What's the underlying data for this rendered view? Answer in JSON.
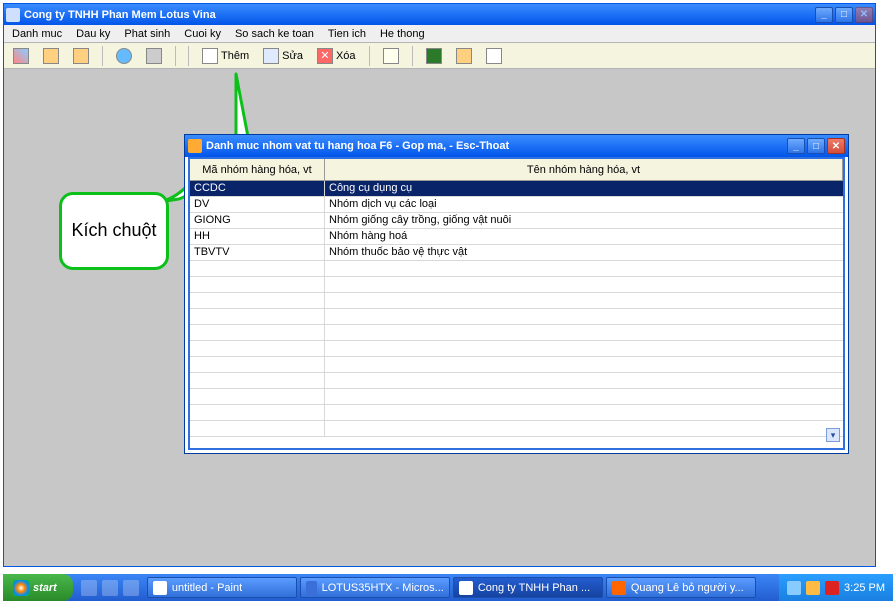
{
  "window": {
    "title": "Cong ty TNHH Phan Mem Lotus Vina"
  },
  "menu": [
    "Danh muc",
    "Dau ky",
    "Phat sinh",
    "Cuoi ky",
    "So sach ke toan",
    "Tien ich",
    "He thong"
  ],
  "toolbar": {
    "them": "Thêm",
    "sua": "Sửa",
    "xoa": "Xóa"
  },
  "callout": {
    "text": "Kích chuột"
  },
  "dialog": {
    "title": "Danh muc nhom vat tu hang hoa   F6 - Gop ma, - Esc-Thoat",
    "columns": {
      "code": "Mã nhóm hàng hóa, vt",
      "name": "Tên nhóm hàng hóa, vt"
    },
    "rows": [
      {
        "code": "CCDC",
        "name": "Công cụ dụng cụ"
      },
      {
        "code": "DV",
        "name": "Nhóm dịch vụ các loại"
      },
      {
        "code": "GIONG",
        "name": "Nhóm giống cây trồng, giống vật nuôi"
      },
      {
        "code": "HH",
        "name": "Nhóm hàng hoá"
      },
      {
        "code": "TBVTV",
        "name": "Nhóm thuốc bảo vệ thực vật"
      }
    ]
  },
  "taskbar": {
    "start": "start",
    "tasks": [
      {
        "label": "untitled - Paint"
      },
      {
        "label": "LOTUS35HTX - Micros..."
      },
      {
        "label": "Cong ty TNHH Phan ..."
      },
      {
        "label": "Quang Lê bỏ người y..."
      }
    ],
    "clock": "3:25 PM"
  }
}
